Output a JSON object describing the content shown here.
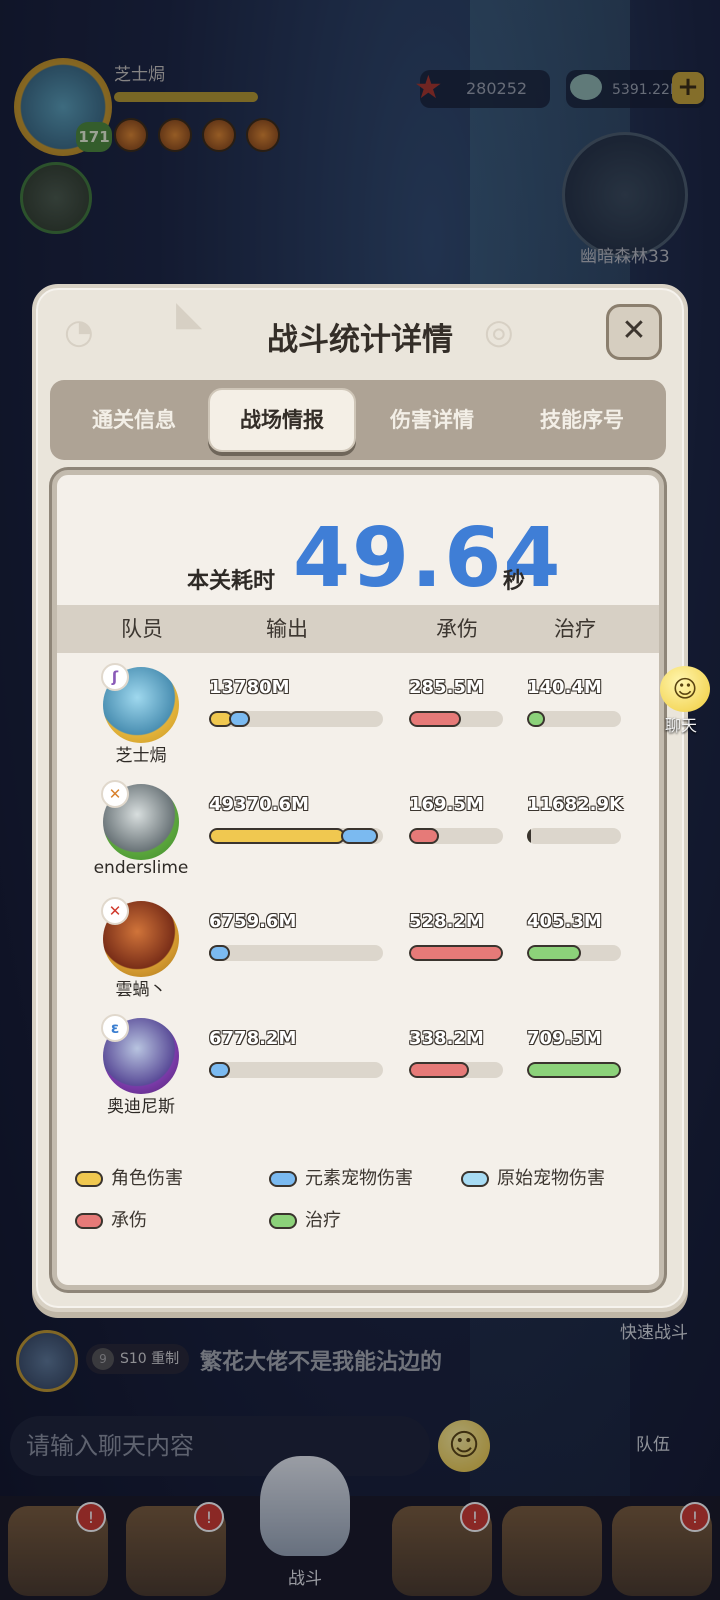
{
  "hud": {
    "player_name": "芝士焗",
    "player_level": "171",
    "starfish_count": "280252",
    "gem_count": "5391.22M",
    "plus_label": "+",
    "map_name": "幽暗森林33"
  },
  "modal": {
    "title": "战斗统计详情",
    "close_label": "✕",
    "tabs": [
      {
        "label": "通关信息",
        "active": false
      },
      {
        "label": "战场情报",
        "active": true
      },
      {
        "label": "伤害详情",
        "active": false
      },
      {
        "label": "技能序号",
        "active": false
      }
    ],
    "time_label": "本关耗时",
    "time_value": "49.64",
    "time_unit": "秒",
    "columns": [
      "队员",
      "输出",
      "承伤",
      "治疗"
    ],
    "members": [
      {
        "name": "芝士焗",
        "element_icon": "ʃ",
        "output": "13780M",
        "taken": "285.5M",
        "heal": "140.4M",
        "output_role": 0.14,
        "output_elem": 0.12,
        "taken_frac": 0.55,
        "heal_frac": 0.19
      },
      {
        "name": "enderslime",
        "element_icon": "✕",
        "output": "49370.6M",
        "taken": "169.5M",
        "heal": "11682.9K",
        "output_role": 0.78,
        "output_elem": 0.21,
        "taken_frac": 0.32,
        "heal_frac": 0.02
      },
      {
        "name": "雲蝸丶",
        "element_icon": "✕",
        "output": "6759.6M",
        "taken": "528.2M",
        "heal": "405.3M",
        "output_role": 0.02,
        "output_elem": 0.12,
        "taken_frac": 1.0,
        "heal_frac": 0.57
      },
      {
        "name": "奥迪尼斯",
        "element_icon": "ɛ",
        "output": "6778.2M",
        "taken": "338.2M",
        "heal": "709.5M",
        "output_role": 0.02,
        "output_elem": 0.12,
        "taken_frac": 0.64,
        "heal_frac": 1.0
      }
    ],
    "legend": [
      {
        "label": "角色伤害",
        "color": "#f0c850"
      },
      {
        "label": "元素宠物伤害",
        "color": "#7bbaf0"
      },
      {
        "label": "原始宠物伤害",
        "color": "#a8dcf4"
      },
      {
        "label": "承伤",
        "color": "#e67a78"
      },
      {
        "label": "治疗",
        "color": "#8cd27a"
      }
    ]
  },
  "chat_float": {
    "icon": "☺",
    "label": "聊天"
  },
  "side": {
    "quick_battle": "快速战斗",
    "team": "队伍"
  },
  "chat": {
    "season_level": "9",
    "season_text": "S10 重制",
    "message": "繁花大佬不是我能沾边的",
    "input_placeholder": "请输入聊天内容",
    "emoji": "☺"
  },
  "bottom_nav": {
    "center_label": "战斗",
    "badge": "!"
  }
}
